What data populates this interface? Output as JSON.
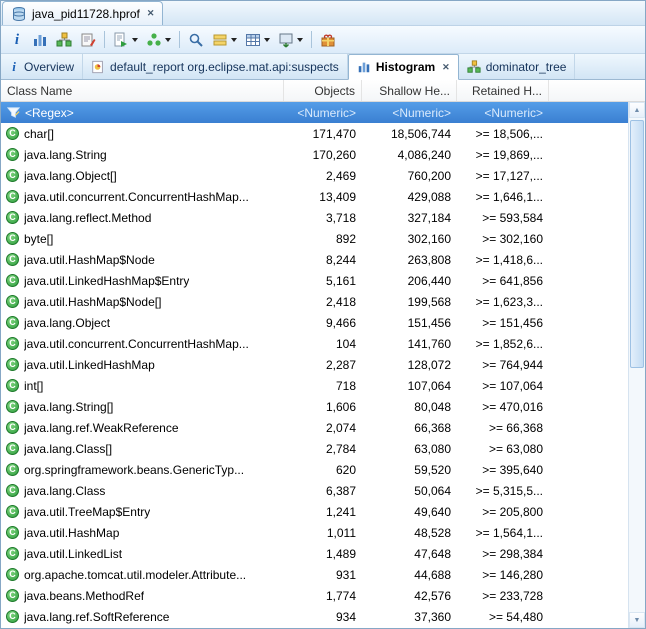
{
  "editor_tab": {
    "title": "java_pid11728.hprof"
  },
  "toolbar": {
    "buttons": [
      "overview",
      "histogram",
      "dominator-tree",
      "oql",
      "run-expert-report",
      "query-browser",
      "search",
      "group-by",
      "calculate-retained-size",
      "export",
      "compare"
    ]
  },
  "view_tabs": {
    "overview": {
      "label": "Overview"
    },
    "default_report": {
      "label": "default_report org.eclipse.mat.api:suspects"
    },
    "histogram": {
      "label": "Histogram",
      "active": true
    },
    "dominator_tree": {
      "label": "dominator_tree"
    }
  },
  "table": {
    "columns": {
      "class_name": "Class Name",
      "objects": "Objects",
      "shallow_heap": "Shallow He...",
      "retained_heap": "Retained H..."
    },
    "filter_row": {
      "class_name": "<Regex>",
      "objects": "<Numeric>",
      "shallow_heap": "<Numeric>",
      "retained_heap": "<Numeric>"
    },
    "rows": [
      {
        "class_name": "char[]",
        "objects": "171,470",
        "shallow_heap": "18,506,744",
        "retained_heap": ">= 18,506,..."
      },
      {
        "class_name": "java.lang.String",
        "objects": "170,260",
        "shallow_heap": "4,086,240",
        "retained_heap": ">= 19,869,..."
      },
      {
        "class_name": "java.lang.Object[]",
        "objects": "2,469",
        "shallow_heap": "760,200",
        "retained_heap": ">= 17,127,..."
      },
      {
        "class_name": "java.util.concurrent.ConcurrentHashMap...",
        "objects": "13,409",
        "shallow_heap": "429,088",
        "retained_heap": ">= 1,646,1..."
      },
      {
        "class_name": "java.lang.reflect.Method",
        "objects": "3,718",
        "shallow_heap": "327,184",
        "retained_heap": ">= 593,584"
      },
      {
        "class_name": "byte[]",
        "objects": "892",
        "shallow_heap": "302,160",
        "retained_heap": ">= 302,160"
      },
      {
        "class_name": "java.util.HashMap$Node",
        "objects": "8,244",
        "shallow_heap": "263,808",
        "retained_heap": ">= 1,418,6..."
      },
      {
        "class_name": "java.util.LinkedHashMap$Entry",
        "objects": "5,161",
        "shallow_heap": "206,440",
        "retained_heap": ">= 641,856"
      },
      {
        "class_name": "java.util.HashMap$Node[]",
        "objects": "2,418",
        "shallow_heap": "199,568",
        "retained_heap": ">= 1,623,3..."
      },
      {
        "class_name": "java.lang.Object",
        "objects": "9,466",
        "shallow_heap": "151,456",
        "retained_heap": ">= 151,456"
      },
      {
        "class_name": "java.util.concurrent.ConcurrentHashMap...",
        "objects": "104",
        "shallow_heap": "141,760",
        "retained_heap": ">= 1,852,6..."
      },
      {
        "class_name": "java.util.LinkedHashMap",
        "objects": "2,287",
        "shallow_heap": "128,072",
        "retained_heap": ">= 764,944"
      },
      {
        "class_name": "int[]",
        "objects": "718",
        "shallow_heap": "107,064",
        "retained_heap": ">= 107,064"
      },
      {
        "class_name": "java.lang.String[]",
        "objects": "1,606",
        "shallow_heap": "80,048",
        "retained_heap": ">= 470,016"
      },
      {
        "class_name": "java.lang.ref.WeakReference",
        "objects": "2,074",
        "shallow_heap": "66,368",
        "retained_heap": ">= 66,368"
      },
      {
        "class_name": "java.lang.Class[]",
        "objects": "2,784",
        "shallow_heap": "63,080",
        "retained_heap": ">= 63,080"
      },
      {
        "class_name": "org.springframework.beans.GenericTyp...",
        "objects": "620",
        "shallow_heap": "59,520",
        "retained_heap": ">= 395,640"
      },
      {
        "class_name": "java.lang.Class",
        "objects": "6,387",
        "shallow_heap": "50,064",
        "retained_heap": ">= 5,315,5..."
      },
      {
        "class_name": "java.util.TreeMap$Entry",
        "objects": "1,241",
        "shallow_heap": "49,640",
        "retained_heap": ">= 205,800"
      },
      {
        "class_name": "java.util.HashMap",
        "objects": "1,011",
        "shallow_heap": "48,528",
        "retained_heap": ">= 1,564,1..."
      },
      {
        "class_name": "java.util.LinkedList",
        "objects": "1,489",
        "shallow_heap": "47,648",
        "retained_heap": ">= 298,384"
      },
      {
        "class_name": "org.apache.tomcat.util.modeler.Attribute...",
        "objects": "931",
        "shallow_heap": "44,688",
        "retained_heap": ">= 146,280"
      },
      {
        "class_name": "java.beans.MethodRef",
        "objects": "1,774",
        "shallow_heap": "42,576",
        "retained_heap": ">= 233,728"
      },
      {
        "class_name": "java.lang.ref.SoftReference",
        "objects": "934",
        "shallow_heap": "37,360",
        "retained_heap": ">= 54,480"
      }
    ]
  },
  "colors": {
    "filter_row_top": "#549de8",
    "filter_row_bottom": "#3a7fd1",
    "class_icon_green": "#2e9e3e",
    "tab_strip_blue": "#d4e6f5",
    "active_tab_bg": "#ffffff"
  }
}
